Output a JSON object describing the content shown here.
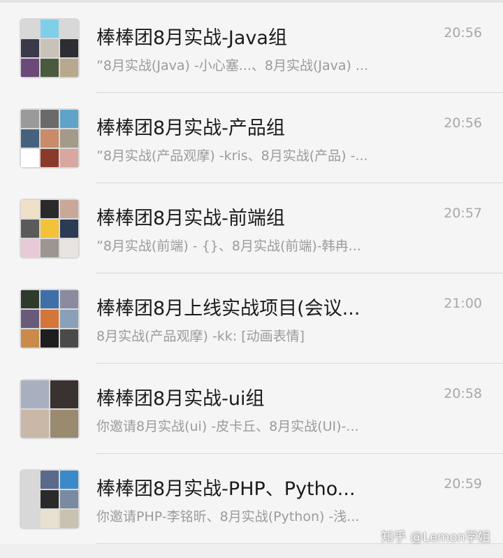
{
  "chats": [
    {
      "title": "棒棒团8月实战-Java组",
      "preview": "”8月实战(Java) -小心塞...、8月实战(Java) ...",
      "time": "20:56",
      "avatar_layout": "g9",
      "avatar_colors": [
        "empty",
        "#7fcfe8",
        "empty",
        "#3a3a4a",
        "#c9c2b8",
        "#2d2d33",
        "#6b4a7a",
        "#4a5a3e",
        "#b8a88e"
      ]
    },
    {
      "title": "棒棒团8月实战-产品组",
      "preview": "”8月实战(产品观摩) -kris、8月实战(产品) -...",
      "time": "20:56",
      "avatar_layout": "g9",
      "avatar_colors": [
        "#9a9a9a",
        "#6a6a6a",
        "#5fa3c9",
        "#46617e",
        "#c98b6a",
        "#a39a8a",
        "#ffffff",
        "#8a3a2a",
        "#d9a6a0"
      ]
    },
    {
      "title": "棒棒团8月实战-前端组",
      "preview": "”8月实战(前端) - {}、8月实战(前端)-韩冉...",
      "time": "20:57",
      "avatar_layout": "g9",
      "avatar_colors": [
        "#f0e0c8",
        "#2a2a2a",
        "#c9a89a",
        "#5a5a5a",
        "#f2c23a",
        "#2b3a55",
        "#e8c9d8",
        "#9c9590",
        "#e8e4e0"
      ]
    },
    {
      "title": "棒棒团8月上线实战项目(会议...",
      "preview": "8月实战(产品观摩) -kk: [动画表情]",
      "time": "21:00",
      "avatar_layout": "g9",
      "avatar_colors": [
        "#2e3a2c",
        "#3f6fa8",
        "#8a8aa0",
        "#6a5a7a",
        "#d4763a",
        "#8aa0b8",
        "#c98a4a",
        "#1e1e1e",
        "#4a4a4a"
      ]
    },
    {
      "title": "棒棒团8月实战-ui组",
      "preview": "你邀请8月实战(ui) -皮卡丘、8月实战(UI)-...",
      "time": "20:58",
      "avatar_layout": "g4",
      "avatar_colors": [
        "#a8b0c0",
        "#3a3230",
        "#c9b8a8",
        "#9a8a70"
      ]
    },
    {
      "title": "棒棒团8月实战-PHP、Pytho...",
      "preview": "你邀请PHP-李铭昕、8月实战(Python) -浅...",
      "time": "20:59",
      "avatar_layout": "g9",
      "avatar_colors": [
        "empty",
        "#5a6a8a",
        "#3a8ac9",
        "empty",
        "#2a2a2a",
        "#7a8aa0",
        "empty",
        "#e8e0d0",
        "#c9c2b0"
      ]
    }
  ],
  "watermark": "知乎 @Lemon学姐"
}
